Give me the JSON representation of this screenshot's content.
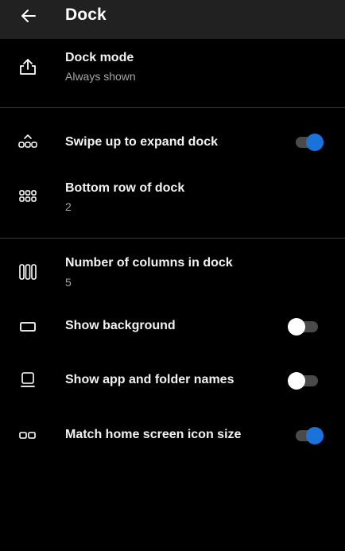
{
  "app_bar": {
    "title": "Dock",
    "back_icon": "arrow-left-icon"
  },
  "settings": [
    {
      "id": "dock-mode",
      "icon": "upload-icon",
      "title": "Dock mode",
      "subtitle": "Always shown"
    },
    {
      "id": "swipe-up",
      "icon": "swipe-up-icon",
      "title": "Swipe up to expand dock",
      "toggle": true
    },
    {
      "id": "bottom-row",
      "icon": "grid-icon",
      "title": "Bottom row of dock",
      "subtitle": "2"
    },
    {
      "id": "columns",
      "icon": "columns-icon",
      "title": "Number of columns in dock",
      "subtitle": "5"
    },
    {
      "id": "background",
      "icon": "rectangle-icon",
      "title": "Show background",
      "toggle": false
    },
    {
      "id": "names",
      "icon": "label-icon",
      "title": "Show app and folder names",
      "toggle": false
    },
    {
      "id": "icon-size",
      "icon": "icon-size-icon",
      "title": "Match home screen icon size",
      "toggle": true
    }
  ],
  "colors": {
    "accent": "#1a73d9",
    "app_bar_bg": "#212121",
    "background": "#000000",
    "divider": "#3a3a3a"
  }
}
